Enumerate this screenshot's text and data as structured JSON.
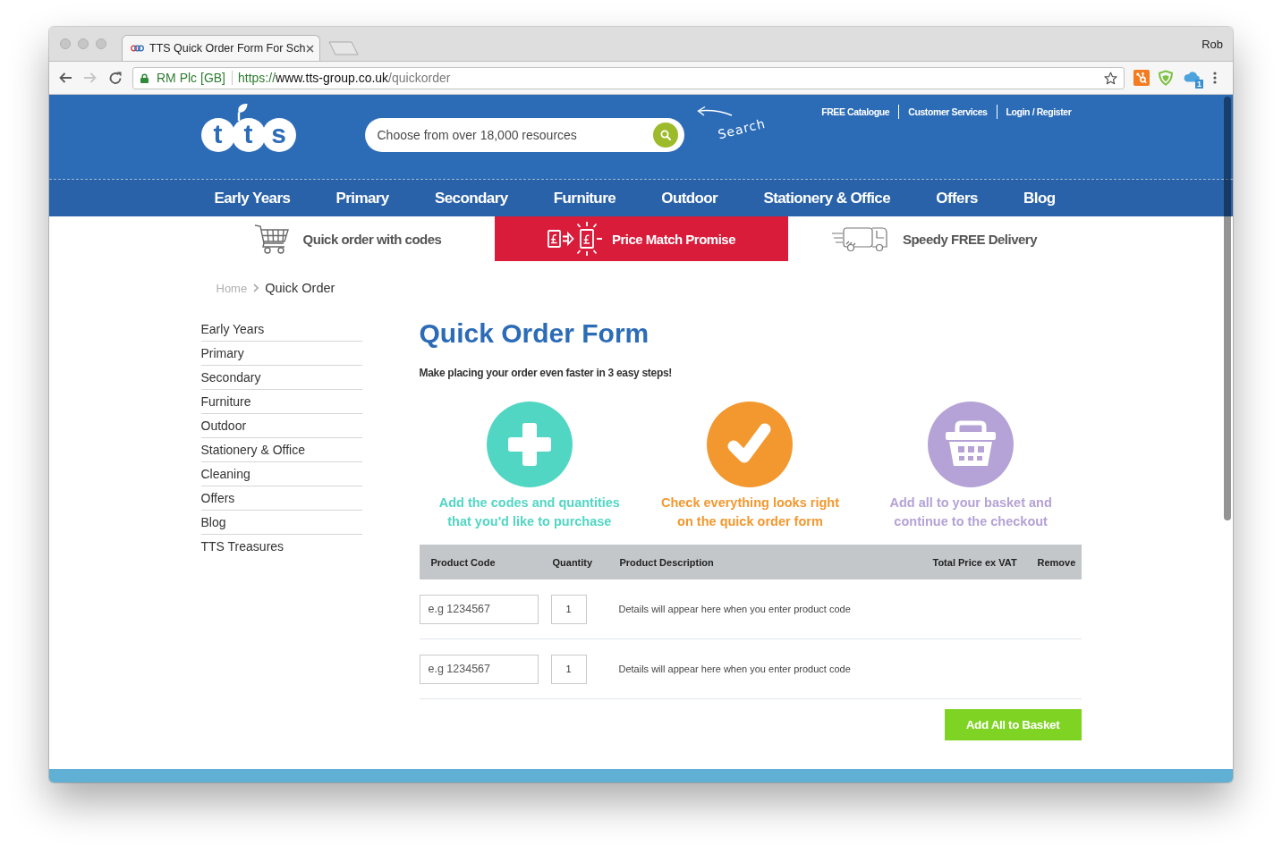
{
  "browser": {
    "tab_title": "TTS Quick Order Form For Sch",
    "profile_name": "Rob",
    "history": {
      "back_disabled": false,
      "forward_disabled": true
    },
    "address": {
      "site_identity": "RM Plc [GB]",
      "scheme": "https://",
      "host": "www.tts-group.co.uk",
      "path": "/quickorder"
    },
    "extension_badge": "1"
  },
  "header": {
    "logo_letters": [
      "t",
      "t",
      "s"
    ],
    "search": {
      "placeholder": "Choose from over 18,000 resources"
    },
    "search_hint": "Search",
    "top_links": [
      "FREE Catalogue",
      "Customer Services",
      "Login / Register"
    ],
    "nav": [
      "Early Years",
      "Primary",
      "Secondary",
      "Furniture",
      "Outdoor",
      "Stationery & Office",
      "Offers",
      "Blog"
    ]
  },
  "promos": [
    {
      "kind": "cart",
      "label": "Quick order with codes",
      "highlighted": false
    },
    {
      "kind": "price_match",
      "label": "Price Match Promise",
      "highlighted": true
    },
    {
      "kind": "truck",
      "label": "Speedy FREE Delivery",
      "highlighted": false
    }
  ],
  "breadcrumb": [
    {
      "label": "Home",
      "current": false
    },
    {
      "label": "Quick Order",
      "current": true
    }
  ],
  "sidebar": {
    "items": [
      "Early Years",
      "Primary",
      "Secondary",
      "Furniture",
      "Outdoor",
      "Stationery & Office",
      "Cleaning",
      "Offers",
      "Blog",
      "TTS Treasures"
    ]
  },
  "quick_order": {
    "title": "Quick Order Form",
    "subtitle": "Make placing your order even faster in 3 easy steps!",
    "steps": [
      {
        "kind": "plus",
        "color": "#52d6c4",
        "lines": [
          "Add the codes and quantities",
          "that you'd like to purchase"
        ]
      },
      {
        "kind": "check",
        "color": "#f3982f",
        "lines": [
          "Check everything looks right",
          "on the quick order form"
        ]
      },
      {
        "kind": "basket",
        "color": "#b5a2d6",
        "lines": [
          "Add all to your basket and",
          "continue to the checkout"
        ]
      }
    ],
    "table": {
      "columns": [
        "Product Code",
        "Quantity",
        "Product Description",
        "Total Price ex VAT",
        "Remove"
      ],
      "rows": [
        {
          "code_placeholder": "e.g 1234567",
          "quantity": "1",
          "description": "Details will appear here when you enter product code"
        },
        {
          "code_placeholder": "e.g 1234567",
          "quantity": "1",
          "description": "Details will appear here when you enter product code"
        }
      ]
    },
    "submit_button": "Add All to Basket"
  }
}
